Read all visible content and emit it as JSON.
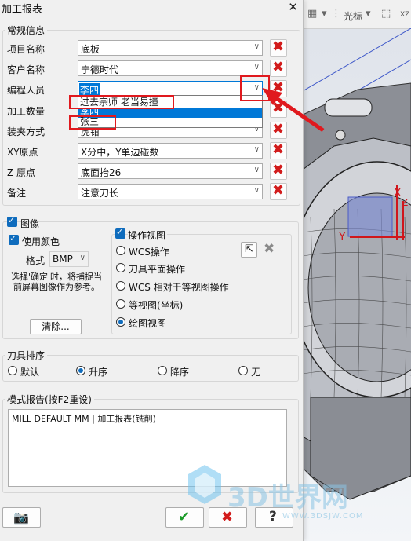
{
  "dialog": {
    "title": "加工报表",
    "close_glyph": "✕"
  },
  "general": {
    "label": "常规信息",
    "fields": [
      {
        "label": "项目名称",
        "value": "底板"
      },
      {
        "label": "客户名称",
        "value": "宁德时代"
      },
      {
        "label": "编程人员",
        "value": "李四"
      },
      {
        "label": "加工数量",
        "value": ""
      },
      {
        "label": "装夹方式",
        "value": "虎钳"
      },
      {
        "label": "XY原点",
        "value": "X分中，Y单边碰数"
      },
      {
        "label": "Z 原点",
        "value": "底面抬26"
      },
      {
        "label": "备注",
        "value": "注意刀长"
      }
    ],
    "dropdown_options": [
      "过去宗师 老当易撞",
      "李四",
      "张三"
    ]
  },
  "image": {
    "image_label": "图像",
    "use_color_label": "使用颜色",
    "format_label": "格式",
    "format_value": "BMP",
    "hint": "选择'确定'时，将捕捉当前屏幕图像作为参考。",
    "clear_label": "清除..."
  },
  "view": {
    "op_view_label": "操作视图",
    "options": [
      "WCS操作",
      "刀具平面操作",
      "WCS 相对于等视图操作",
      "等视图(坐标)",
      "绘图视图"
    ],
    "selected_index": 4
  },
  "tool_sort": {
    "label": "刀具排序",
    "options": [
      "默认",
      "升序",
      "降序",
      "无"
    ],
    "selected_index": 1
  },
  "report": {
    "label": "模式报告(按F2重设)",
    "text": "MILL DEFAULT MM  |  加工报表(铣削)"
  },
  "viewport": {
    "toolbar_text": "光标",
    "axis_x": "X",
    "axis_y": "Y",
    "axis_z": "Z",
    "toolbar_corner": "XZ"
  },
  "watermark": {
    "brand": "3D世界网",
    "url": "WWW.3DSJW.COM"
  },
  "colors": {
    "accent": "#0f6cbd",
    "delete_red": "#d21b1b",
    "annotation_red": "#e0191e",
    "highlight": "#0078d7"
  }
}
